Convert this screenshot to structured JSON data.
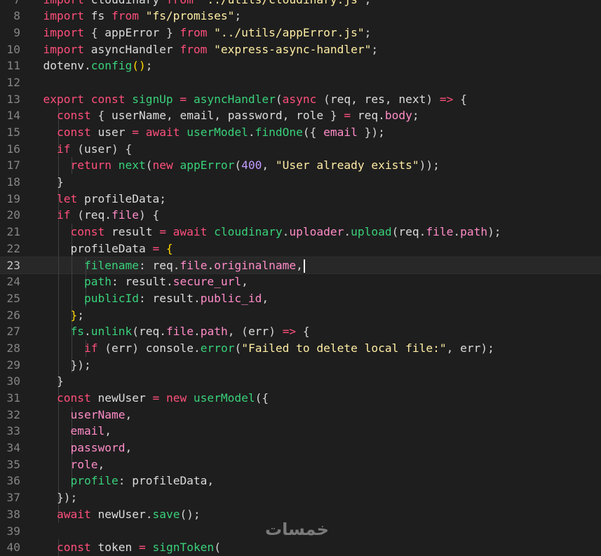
{
  "editor": {
    "current_line": 23,
    "lines": [
      {
        "n": "7",
        "t": [
          [
            "kw",
            "import"
          ],
          [
            "var",
            " cloudinary "
          ],
          [
            "kw",
            "from"
          ],
          [
            "str",
            " \"../utils/cloudinary.js\""
          ],
          [
            "pun",
            ";"
          ]
        ]
      },
      {
        "n": "8",
        "t": [
          [
            "kw",
            "import"
          ],
          [
            "var",
            " fs "
          ],
          [
            "kw",
            "from"
          ],
          [
            "str",
            " \"fs/promises\""
          ],
          [
            "pun",
            ";"
          ]
        ]
      },
      {
        "n": "9",
        "t": [
          [
            "kw",
            "import"
          ],
          [
            "pun",
            " { "
          ],
          [
            "var",
            "appError"
          ],
          [
            "pun",
            " } "
          ],
          [
            "kw",
            "from"
          ],
          [
            "str",
            " \"../utils/appError.js\""
          ],
          [
            "pun",
            ";"
          ]
        ]
      },
      {
        "n": "10",
        "t": [
          [
            "kw",
            "import"
          ],
          [
            "var",
            " asyncHandler "
          ],
          [
            "kw",
            "from"
          ],
          [
            "str",
            " \"express-async-handler\""
          ],
          [
            "pun",
            ";"
          ]
        ]
      },
      {
        "n": "11",
        "t": [
          [
            "var",
            "dotenv"
          ],
          [
            "pun",
            "."
          ],
          [
            "fn",
            "config"
          ],
          [
            "br",
            "()"
          ],
          [
            "pun",
            ";"
          ]
        ]
      },
      {
        "n": "12",
        "t": []
      },
      {
        "n": "13",
        "t": [
          [
            "kw",
            "export const "
          ],
          [
            "fn",
            "signUp"
          ],
          [
            "opr",
            " = "
          ],
          [
            "fn",
            "asyncHandler"
          ],
          [
            "pun",
            "("
          ],
          [
            "kw",
            "async"
          ],
          [
            "pun",
            " ("
          ],
          [
            "var",
            "req"
          ],
          [
            "pun",
            ", "
          ],
          [
            "var",
            "res"
          ],
          [
            "pun",
            ", "
          ],
          [
            "var",
            "next"
          ],
          [
            "pun",
            ") "
          ],
          [
            "opr",
            "=>"
          ],
          [
            "pun",
            " {"
          ]
        ]
      },
      {
        "n": "14",
        "t": [
          [
            "pun",
            "  "
          ],
          [
            "kw",
            "const"
          ],
          [
            "pun",
            " { "
          ],
          [
            "var",
            "userName"
          ],
          [
            "pun",
            ", "
          ],
          [
            "var",
            "email"
          ],
          [
            "pun",
            ", "
          ],
          [
            "var",
            "password"
          ],
          [
            "pun",
            ", "
          ],
          [
            "var",
            "role"
          ],
          [
            "pun",
            " } "
          ],
          [
            "opr",
            "="
          ],
          [
            "var",
            " req"
          ],
          [
            "pun",
            "."
          ],
          [
            "prop",
            "body"
          ],
          [
            "pun",
            ";"
          ]
        ]
      },
      {
        "n": "15",
        "t": [
          [
            "pun",
            "  "
          ],
          [
            "kw",
            "const"
          ],
          [
            "var",
            " user "
          ],
          [
            "opr",
            "="
          ],
          [
            "kw",
            " await "
          ],
          [
            "fn",
            "userModel"
          ],
          [
            "pun",
            "."
          ],
          [
            "fn",
            "findOne"
          ],
          [
            "pun",
            "({ "
          ],
          [
            "prop",
            "email"
          ],
          [
            "pun",
            " });"
          ]
        ]
      },
      {
        "n": "16",
        "t": [
          [
            "pun",
            "  "
          ],
          [
            "kw",
            "if"
          ],
          [
            "pun",
            " ("
          ],
          [
            "var",
            "user"
          ],
          [
            "pun",
            ") {"
          ]
        ]
      },
      {
        "n": "17",
        "t": [
          [
            "pun",
            "    "
          ],
          [
            "kw",
            "return"
          ],
          [
            "fn",
            " next"
          ],
          [
            "pun",
            "("
          ],
          [
            "kw",
            "new"
          ],
          [
            "fn",
            " appError"
          ],
          [
            "pun",
            "("
          ],
          [
            "num",
            "400"
          ],
          [
            "pun",
            ", "
          ],
          [
            "str",
            "\"User already exists\""
          ],
          [
            "pun",
            "));"
          ]
        ]
      },
      {
        "n": "18",
        "t": [
          [
            "pun",
            "  }"
          ]
        ]
      },
      {
        "n": "19",
        "t": [
          [
            "pun",
            "  "
          ],
          [
            "kw",
            "let"
          ],
          [
            "var",
            " profileData"
          ],
          [
            "pun",
            ";"
          ]
        ]
      },
      {
        "n": "20",
        "t": [
          [
            "pun",
            "  "
          ],
          [
            "kw",
            "if"
          ],
          [
            "pun",
            " ("
          ],
          [
            "var",
            "req"
          ],
          [
            "pun",
            "."
          ],
          [
            "prop",
            "file"
          ],
          [
            "pun",
            ") {"
          ]
        ]
      },
      {
        "n": "21",
        "t": [
          [
            "pun",
            "    "
          ],
          [
            "kw",
            "const"
          ],
          [
            "var",
            " result "
          ],
          [
            "opr",
            "="
          ],
          [
            "kw",
            " await "
          ],
          [
            "fn",
            "cloudinary"
          ],
          [
            "pun",
            "."
          ],
          [
            "prop",
            "uploader"
          ],
          [
            "pun",
            "."
          ],
          [
            "fn",
            "upload"
          ],
          [
            "pun",
            "("
          ],
          [
            "var",
            "req"
          ],
          [
            "pun",
            "."
          ],
          [
            "prop",
            "file"
          ],
          [
            "pun",
            "."
          ],
          [
            "prop",
            "path"
          ],
          [
            "pun",
            ");"
          ]
        ]
      },
      {
        "n": "22",
        "t": [
          [
            "pun",
            "    "
          ],
          [
            "var",
            "profileData "
          ],
          [
            "opr",
            "="
          ],
          [
            "br",
            " {"
          ]
        ]
      },
      {
        "n": "23",
        "t": [
          [
            "pun",
            "      "
          ],
          [
            "attr",
            "filename"
          ],
          [
            "pun",
            ": "
          ],
          [
            "var",
            "req"
          ],
          [
            "pun",
            "."
          ],
          [
            "prop",
            "file"
          ],
          [
            "pun",
            "."
          ],
          [
            "prop",
            "originalname"
          ],
          [
            "pun",
            ","
          ]
        ]
      },
      {
        "n": "24",
        "t": [
          [
            "pun",
            "      "
          ],
          [
            "attr",
            "path"
          ],
          [
            "pun",
            ": "
          ],
          [
            "var",
            "result"
          ],
          [
            "pun",
            "."
          ],
          [
            "prop",
            "secure_url"
          ],
          [
            "pun",
            ","
          ]
        ]
      },
      {
        "n": "25",
        "t": [
          [
            "pun",
            "      "
          ],
          [
            "attr",
            "publicId"
          ],
          [
            "pun",
            ": "
          ],
          [
            "var",
            "result"
          ],
          [
            "pun",
            "."
          ],
          [
            "prop",
            "public_id"
          ],
          [
            "pun",
            ","
          ]
        ]
      },
      {
        "n": "26",
        "t": [
          [
            "pun",
            "    "
          ],
          [
            "br",
            "}"
          ],
          [
            "pun",
            ";"
          ]
        ]
      },
      {
        "n": "27",
        "t": [
          [
            "pun",
            "    "
          ],
          [
            "fn",
            "fs"
          ],
          [
            "pun",
            "."
          ],
          [
            "fn",
            "unlink"
          ],
          [
            "pun",
            "("
          ],
          [
            "var",
            "req"
          ],
          [
            "pun",
            "."
          ],
          [
            "prop",
            "file"
          ],
          [
            "pun",
            "."
          ],
          [
            "prop",
            "path"
          ],
          [
            "pun",
            ", ("
          ],
          [
            "var",
            "err"
          ],
          [
            "pun",
            ") "
          ],
          [
            "opr",
            "=>"
          ],
          [
            "pun",
            " {"
          ]
        ]
      },
      {
        "n": "28",
        "t": [
          [
            "pun",
            "      "
          ],
          [
            "kw",
            "if"
          ],
          [
            "pun",
            " ("
          ],
          [
            "var",
            "err"
          ],
          [
            "pun",
            ") "
          ],
          [
            "var",
            "console"
          ],
          [
            "pun",
            "."
          ],
          [
            "fn",
            "error"
          ],
          [
            "pun",
            "("
          ],
          [
            "str",
            "\"Failed to delete local file:\""
          ],
          [
            "pun",
            ", "
          ],
          [
            "var",
            "err"
          ],
          [
            "pun",
            ");"
          ]
        ]
      },
      {
        "n": "29",
        "t": [
          [
            "pun",
            "    });"
          ]
        ]
      },
      {
        "n": "30",
        "t": [
          [
            "pun",
            "  }"
          ]
        ]
      },
      {
        "n": "31",
        "t": [
          [
            "pun",
            "  "
          ],
          [
            "kw",
            "const"
          ],
          [
            "var",
            " newUser "
          ],
          [
            "opr",
            "="
          ],
          [
            "kw",
            " new"
          ],
          [
            "fn",
            " userModel"
          ],
          [
            "pun",
            "({"
          ]
        ]
      },
      {
        "n": "32",
        "t": [
          [
            "pun",
            "    "
          ],
          [
            "prop",
            "userName"
          ],
          [
            "pun",
            ","
          ]
        ]
      },
      {
        "n": "33",
        "t": [
          [
            "pun",
            "    "
          ],
          [
            "prop",
            "email"
          ],
          [
            "pun",
            ","
          ]
        ]
      },
      {
        "n": "34",
        "t": [
          [
            "pun",
            "    "
          ],
          [
            "prop",
            "password"
          ],
          [
            "pun",
            ","
          ]
        ]
      },
      {
        "n": "35",
        "t": [
          [
            "pun",
            "    "
          ],
          [
            "prop",
            "role"
          ],
          [
            "pun",
            ","
          ]
        ]
      },
      {
        "n": "36",
        "t": [
          [
            "pun",
            "    "
          ],
          [
            "attr",
            "profile"
          ],
          [
            "pun",
            ": "
          ],
          [
            "var",
            "profileData"
          ],
          [
            "pun",
            ","
          ]
        ]
      },
      {
        "n": "37",
        "t": [
          [
            "pun",
            "  });"
          ]
        ]
      },
      {
        "n": "38",
        "t": [
          [
            "pun",
            "  "
          ],
          [
            "kw",
            "await"
          ],
          [
            "var",
            " newUser"
          ],
          [
            "pun",
            "."
          ],
          [
            "fn",
            "save"
          ],
          [
            "pun",
            "();"
          ]
        ]
      },
      {
        "n": "39",
        "t": []
      },
      {
        "n": "40",
        "t": [
          [
            "pun",
            "  "
          ],
          [
            "kw",
            "const"
          ],
          [
            "var",
            " token "
          ],
          [
            "opr",
            "="
          ],
          [
            "fn",
            " signToken"
          ],
          [
            "pun",
            "("
          ]
        ]
      }
    ]
  },
  "watermark": "خمسات",
  "colors": {
    "background": "#1e1e1e",
    "keyword": "#ff4f7b",
    "function": "#39d17a",
    "string": "#ffeda4",
    "line_number": "#858585"
  }
}
